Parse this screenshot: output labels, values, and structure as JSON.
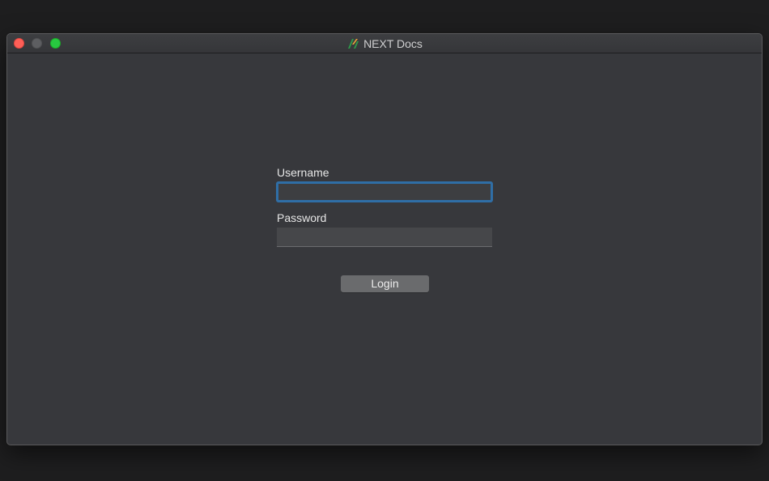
{
  "window": {
    "title": "NEXT Docs",
    "app_icon": "next-docs-logo-icon",
    "controls": [
      "close",
      "minimize",
      "zoom"
    ]
  },
  "login_form": {
    "username_label": "Username",
    "username_value": "",
    "password_label": "Password",
    "password_value": "",
    "login_label": "Login",
    "focused_field": "username"
  },
  "colors": {
    "window_bg": "#37383c",
    "focus_ring": "#2f6ea6",
    "close": "#fe5f57",
    "zoom": "#28c840",
    "button_bg": "#6a6b6d"
  }
}
